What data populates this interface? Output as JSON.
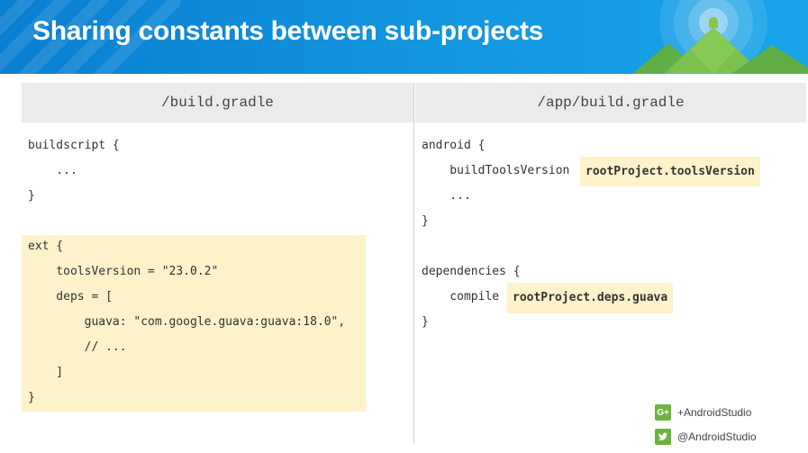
{
  "slide": {
    "title": "Sharing constants between sub-projects"
  },
  "left_panel": {
    "header": "/build.gradle",
    "buildscript_lines": [
      "buildscript {",
      "    ...",
      "}"
    ],
    "ext_lines": [
      "ext {",
      "    toolsVersion = \"23.0.2\"",
      "    deps = [",
      "        guava: \"com.google.guava:guava:18.0\",",
      "        // ...",
      "    ]",
      "}"
    ]
  },
  "right_panel": {
    "header": "/app/build.gradle",
    "android_open": "android {",
    "build_tools_prefix": "    buildToolsVersion ",
    "build_tools_value": "rootProject.toolsVersion",
    "ellipsis": "    ...",
    "android_close": "}",
    "dependencies_open": "dependencies {",
    "compile_prefix": "    compile ",
    "compile_value": "rootProject.deps.guava",
    "dependencies_close": "}"
  },
  "social": {
    "gplus_handle": "+AndroidStudio",
    "twitter_handle": "@AndroidStudio",
    "gplus_icon": "google-plus-icon",
    "twitter_icon": "twitter-icon"
  },
  "colors": {
    "header_blue": "#1296e0",
    "highlight": "#fdf2c9",
    "column_header": "#ebebeb",
    "social_green": "#6db33f"
  }
}
